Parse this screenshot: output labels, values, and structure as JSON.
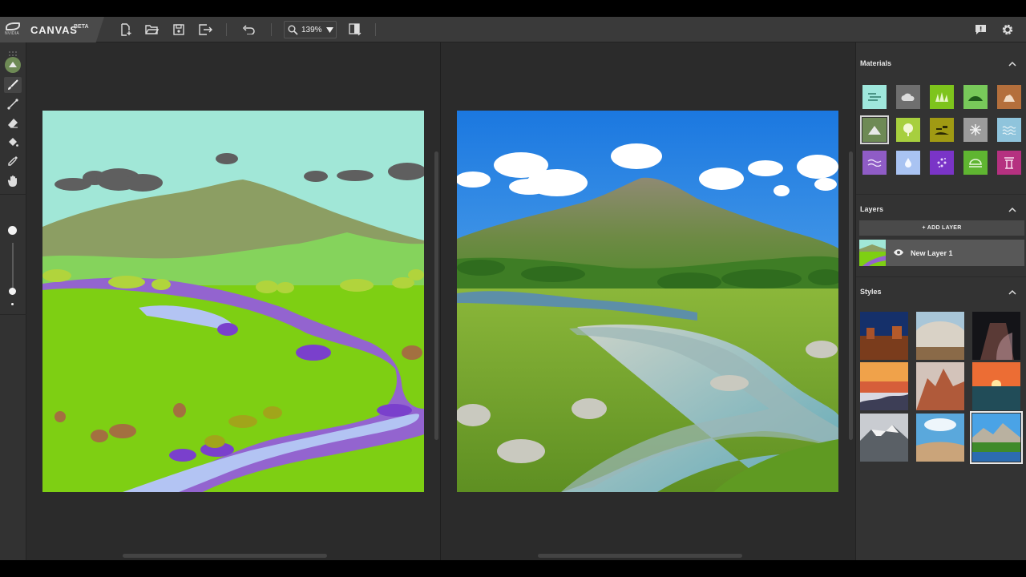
{
  "app": {
    "name": "CANVAS",
    "badge": "BETA",
    "logo_text": "NVIDIA",
    "logo_icon": "nvidia-eye-logo-icon"
  },
  "toolbar": {
    "icons": [
      "new-file-icon",
      "open-folder-icon",
      "save-icon",
      "export-icon",
      "undo-icon"
    ],
    "zoom_value": "139%",
    "compare_icon": "split-view-icon",
    "right_icons": [
      "feedback-icon",
      "gear-icon"
    ]
  },
  "tools": [
    "paint-mode-icon",
    "brush-icon",
    "line-icon",
    "eraser-icon",
    "fill-bucket-icon",
    "eyedropper-icon",
    "hand-icon"
  ],
  "brush": {
    "size_level": 0.12
  },
  "panel": {
    "materials_title": "Materials",
    "materials": [
      {
        "name": "sky",
        "color": "#9fe7dc",
        "icon": "sky-icon"
      },
      {
        "name": "cloud",
        "color": "#6f6f6f",
        "icon": "cloud-icon"
      },
      {
        "name": "grass",
        "color": "#7ec41c",
        "icon": "grass-icon"
      },
      {
        "name": "hill",
        "color": "#78c95a",
        "icon": "hill-icon"
      },
      {
        "name": "rock",
        "color": "#b46f3c",
        "icon": "rock-icon"
      },
      {
        "name": "mountain",
        "color": "#6e8a55",
        "icon": "mountain-icon",
        "selected": true
      },
      {
        "name": "tree",
        "color": "#a7cf3e",
        "icon": "tree-icon"
      },
      {
        "name": "dirt",
        "color": "#a09a13",
        "icon": "dirt-icon"
      },
      {
        "name": "snow",
        "color": "#9c9c9c",
        "icon": "snowflake-icon"
      },
      {
        "name": "water",
        "color": "#8fc4dc",
        "icon": "water-icon"
      },
      {
        "name": "river",
        "color": "#8f5cc6",
        "icon": "river-icon"
      },
      {
        "name": "fog",
        "color": "#a9c3f2",
        "icon": "drop-icon"
      },
      {
        "name": "flower",
        "color": "#7a34c7",
        "icon": "flower-icon"
      },
      {
        "name": "bush",
        "color": "#5fb531",
        "icon": "bush-icon"
      },
      {
        "name": "building",
        "color": "#b53180",
        "icon": "building-icon"
      }
    ],
    "layers_title": "Layers",
    "add_layer_label": "+ ADD LAYER",
    "layer_name": "New Layer 1",
    "styles_title": "Styles",
    "styles": [
      "style-1",
      "style-2",
      "style-3",
      "style-4",
      "style-5",
      "style-6",
      "style-7",
      "style-8",
      "style-9"
    ]
  }
}
